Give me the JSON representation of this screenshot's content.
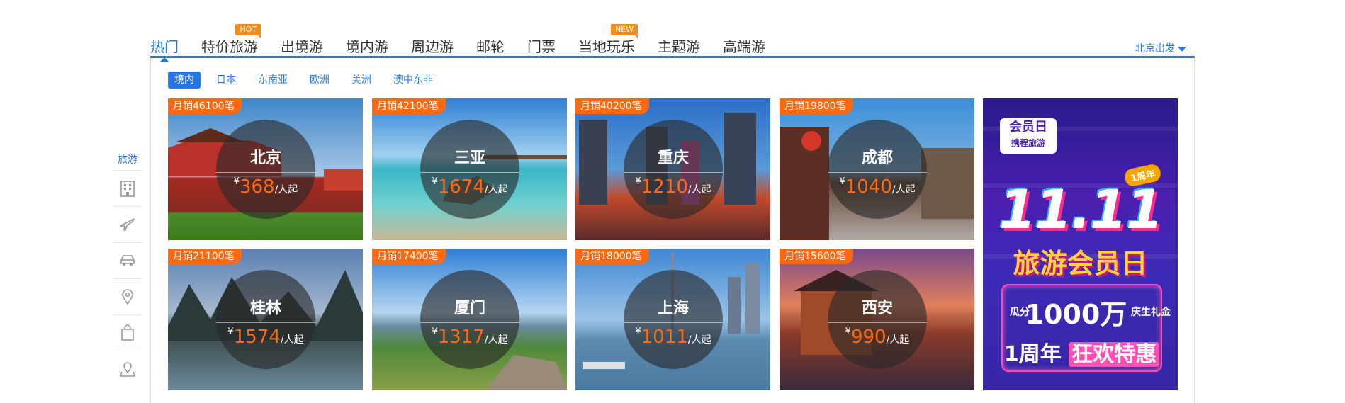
{
  "nav": {
    "tabs": [
      {
        "label": "热门"
      },
      {
        "label": "特价旅游",
        "tag": "HOT"
      },
      {
        "label": "出境游"
      },
      {
        "label": "境内游"
      },
      {
        "label": "周边游"
      },
      {
        "label": "邮轮"
      },
      {
        "label": "门票"
      },
      {
        "label": "当地玩乐",
        "tag": "NEW"
      },
      {
        "label": "主题游"
      },
      {
        "label": "高端游"
      }
    ],
    "departure": "北京出发"
  },
  "subtabs": [
    "境内",
    "日本",
    "东南亚",
    "欧洲",
    "美洲",
    "澳中东非"
  ],
  "sidebar": {
    "label": "旅游",
    "icons": [
      "hotel-icon",
      "plane-icon",
      "car-icon",
      "location-pin-icon",
      "shopping-bag-icon",
      "map-pin-icon"
    ]
  },
  "destinations": [
    {
      "sales": "月销46100笔",
      "name": "北京",
      "currency": "¥",
      "price": "368",
      "unit": "/人起"
    },
    {
      "sales": "月销42100笔",
      "name": "三亚",
      "currency": "¥",
      "price": "1674",
      "unit": "/人起"
    },
    {
      "sales": "月销40200笔",
      "name": "重庆",
      "currency": "¥",
      "price": "1210",
      "unit": "/人起"
    },
    {
      "sales": "月销19800笔",
      "name": "成都",
      "currency": "¥",
      "price": "1040",
      "unit": "/人起"
    },
    {
      "sales": "月销21100笔",
      "name": "桂林",
      "currency": "¥",
      "price": "1574",
      "unit": "/人起"
    },
    {
      "sales": "月销17400笔",
      "name": "厦门",
      "currency": "¥",
      "price": "1317",
      "unit": "/人起"
    },
    {
      "sales": "月销18000笔",
      "name": "上海",
      "currency": "¥",
      "price": "1011",
      "unit": "/人起"
    },
    {
      "sales": "月销15600笔",
      "name": "西安",
      "currency": "¥",
      "price": "990",
      "unit": "/人起"
    }
  ],
  "promo": {
    "logo_line1": "会员日",
    "logo_line2": "携程旅游",
    "ribbon": "1周年",
    "big": "11.11",
    "title": "旅游会员日",
    "small1": "瓜分",
    "amount": "1000万",
    "small2": "庆生礼金",
    "line2a": "1周年",
    "line2b": "狂欢特惠"
  },
  "colors": {
    "accent": "#2577e3",
    "badge": "#ff6a10",
    "price": "#ff6a10",
    "hot_tag": "#f68b1d"
  }
}
